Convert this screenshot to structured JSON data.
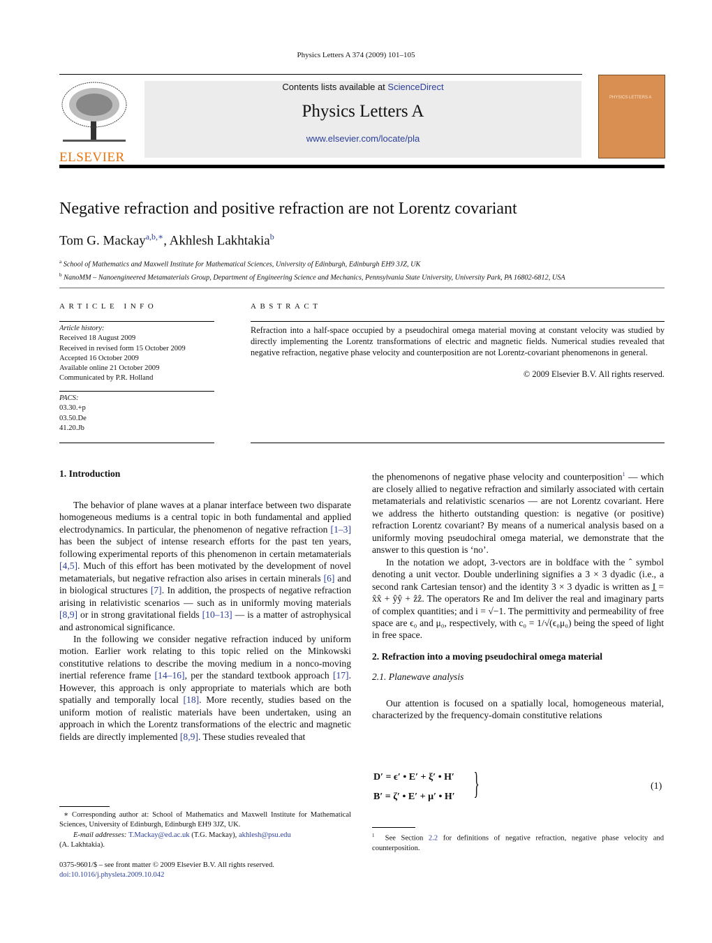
{
  "journal_ref": "Physics Letters A 374 (2009) 101–105",
  "header": {
    "contents_prefix": "Contents lists available at ",
    "sciencedirect": "ScienceDirect",
    "journal_title": "Physics Letters A",
    "url": "www.elsevier.com/locate/pla",
    "publisher": "ELSEVIER",
    "cover_title": "PHYSICS LETTERS A"
  },
  "article": {
    "title": "Negative refraction and positive refraction are not Lorentz covariant",
    "authors": [
      {
        "name": "Tom G. Mackay",
        "sup": "a,b,∗"
      },
      {
        "name": "Akhlesh Lakhtakia",
        "sup": "b"
      }
    ],
    "affiliations": [
      {
        "sup": "a",
        "text": "School of Mathematics and Maxwell Institute for Mathematical Sciences, University of Edinburgh, Edinburgh EH9 3JZ, UK"
      },
      {
        "sup": "b",
        "text": "NanoMM – Nanoengineered Metamaterials Group, Department of Engineering Science and Mechanics, Pennsylvania State University, University Park, PA 16802-6812, USA"
      }
    ]
  },
  "info": {
    "heading": "ARTICLE INFO",
    "history_label": "Article history:",
    "history": [
      "Received 18 August 2009",
      "Received in revised form 15 October 2009",
      "Accepted 16 October 2009",
      "Available online 21 October 2009",
      "Communicated by P.R. Holland"
    ],
    "pacs_label": "PACS:",
    "pacs": [
      "03.30.+p",
      "03.50.De",
      "41.20.Jb"
    ]
  },
  "abstract": {
    "heading": "ABSTRACT",
    "text": "Refraction into a half-space occupied by a pseudochiral omega material moving at constant velocity was studied by directly implementing the Lorentz transformations of electric and magnetic fields. Numerical studies revealed that negative refraction, negative phase velocity and counterposition are not Lorentz-covariant phenomenons in general.",
    "copyright": "© 2009 Elsevier B.V. All rights reserved."
  },
  "left_col": {
    "section1": "1.  Introduction",
    "paragraphs": [
      [
        {
          "t": "The behavior of plane waves at a planar interface between two disparate homogeneous mediums is a central topic in both fundamental and applied electrodynamics. In particular, the phenomenon of negative refraction "
        },
        {
          "t": "[1–3]",
          "l": 1
        },
        {
          "t": " has been the subject of intense research efforts for the past ten years, following experimental reports of this phenomenon in certain metamaterials "
        },
        {
          "t": "[4,5]",
          "l": 1
        },
        {
          "t": ". Much of this effort has been motivated by the development of novel metamaterials, but negative refraction also arises in certain minerals "
        },
        {
          "t": "[6]",
          "l": 1
        },
        {
          "t": " and in biological structures "
        },
        {
          "t": "[7]",
          "l": 1
        },
        {
          "t": ". In addition, the prospects of negative refraction arising in relativistic scenarios — such as in uniformly moving materials "
        },
        {
          "t": "[8,9]",
          "l": 1
        },
        {
          "t": " or in strong gravitational fields "
        },
        {
          "t": "[10–13]",
          "l": 1
        },
        {
          "t": " — is a matter of astrophysical and astronomical significance."
        }
      ],
      [
        {
          "t": "In the following we consider negative refraction induced by uniform motion. Earlier work relating to this topic relied on the Minkowski constitutive relations to describe the moving medium in a nonco-moving inertial reference frame "
        },
        {
          "t": "[14–16]",
          "l": 1
        },
        {
          "t": ", per the standard textbook approach "
        },
        {
          "t": "[17]",
          "l": 1
        },
        {
          "t": ". However, this approach is only appropriate to materials which are both spatially and temporally local "
        },
        {
          "t": "[18]",
          "l": 1
        },
        {
          "t": ". More recently, studies based on the uniform motion of realistic materials have been undertaken, using an approach in which the Lorentz transformations of the electric and magnetic fields are directly implemented "
        },
        {
          "t": "[8,9]",
          "l": 1
        },
        {
          "t": ". These studies revealed that"
        }
      ]
    ],
    "footnote": [
      {
        "t": "∗ Corresponding author at: School of Mathematics and Maxwell Institute for Mathematical Sciences, University of Edinburgh, Edinburgh EH9 3JZ, UK."
      }
    ],
    "email_label": "E-mail addresses: ",
    "email1": "T.Mackay@ed.ac.uk",
    "email1_who": " (T.G. Mackay), ",
    "email2": "akhlesh@psu.edu",
    "email2_who": "(A. Lakhtakia).",
    "issn": "0375-9601/$ – see front matter  © 2009 Elsevier B.V. All rights reserved.",
    "doi": "doi:10.1016/j.physleta.2009.10.042"
  },
  "right_col": {
    "p1": [
      {
        "t": "the phenomenons of negative phase velocity and counterposition"
      },
      {
        "t": "1",
        "s": 1
      },
      {
        "t": " — which are closely allied to negative refraction and similarly associated with certain metamaterials and relativistic scenarios — are not Lorentz covariant. Here we address the hitherto outstanding question: is negative (or positive) refraction Lorentz covariant? By means of a numerical analysis based on a uniformly moving pseudochiral omega material, we demonstrate that the answer to this question is ‘no’."
      }
    ],
    "p2": [
      {
        "t": "In the notation we adopt, 3-vectors are in boldface with the ˆ symbol denoting a unit vector. Double underlining signifies a 3 × 3 dyadic (i.e., a second rank Cartesian tensor) and the identity 3 × 3 dyadic is written as I̲̲ = x̂x̂ + ŷŷ + ẑẑ. The operators Re and Im deliver the real and imaginary parts of complex quantities; and i = √−1. The permittivity and permeability of free space are ϵ₀ and μ₀, respectively, with c₀ = 1/√(ϵ₀μ₀) being the speed of light in free space."
      }
    ],
    "section2": "2.  Refraction into a moving pseudochiral omega material",
    "subsection": "2.1.  Planewave analysis",
    "p3": [
      {
        "t": "Our attention is focused on a spatially local, homogeneous material, characterized by the frequency-domain constitutive relations"
      }
    ],
    "eq1": "D′ = ϵ′ • E′ + ξ′ • H′",
    "eq2": "B′ = ζ′ • E′ + μ′ • H′",
    "eq_num": "(1)",
    "fn_num": "1",
    "fn_pre": "See Section ",
    "fn_link": "2.2",
    "fn_post": " for definitions of negative refraction, negative phase velocity and counterposition."
  }
}
